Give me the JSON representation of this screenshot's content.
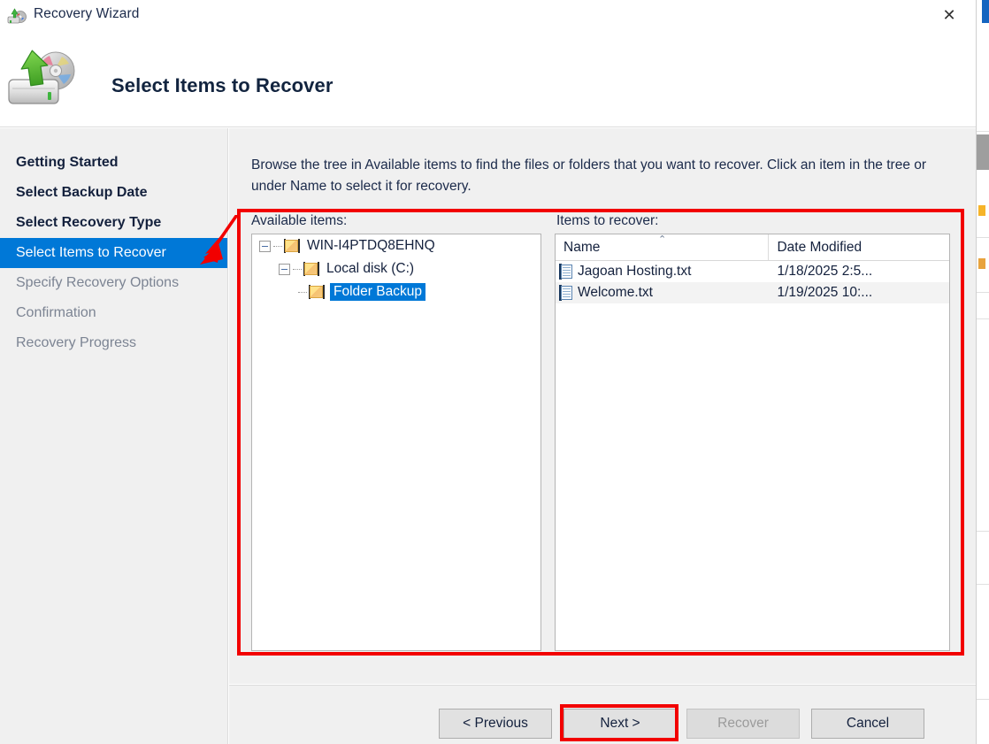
{
  "window": {
    "title": "Recovery Wizard",
    "title_icon": "recovery-wizard-icon",
    "close_label": "✕",
    "banner_title": "Select Items to Recover",
    "banner_icon": "backup-restore-icon"
  },
  "sidebar": {
    "items": [
      {
        "label": "Getting Started",
        "state": "done"
      },
      {
        "label": "Select Backup Date",
        "state": "done"
      },
      {
        "label": "Select Recovery Type",
        "state": "done"
      },
      {
        "label": "Select Items to Recover",
        "state": "active"
      },
      {
        "label": "Specify Recovery Options",
        "state": "pending"
      },
      {
        "label": "Confirmation",
        "state": "pending"
      },
      {
        "label": "Recovery Progress",
        "state": "pending"
      }
    ]
  },
  "main": {
    "instruction": "Browse the tree in Available items to find the files or folders that you want to recover. Click an item in the tree or under Name to select it for recovery.",
    "available_label": "Available items:",
    "items_label": "Items to recover:",
    "tree": [
      {
        "label": "WIN-I4PTDQ8EHNQ",
        "depth": 1,
        "expanded": true,
        "selected": false
      },
      {
        "label": "Local disk (C:)",
        "depth": 2,
        "expanded": true,
        "selected": false
      },
      {
        "label": "Folder Backup",
        "depth": 3,
        "expanded": false,
        "selected": true
      }
    ],
    "list": {
      "columns": [
        {
          "label": "Name",
          "sorted": "ascending",
          "sort_glyph": "⌃"
        },
        {
          "label": "Date Modified",
          "sorted": "none",
          "sort_glyph": ""
        }
      ],
      "rows": [
        {
          "name": "Jagoan Hosting.txt",
          "date": "1/18/2025 2:5...",
          "icon": "text-file-icon"
        },
        {
          "name": "Welcome.txt",
          "date": "1/19/2025 10:...",
          "icon": "text-file-icon"
        }
      ]
    }
  },
  "footer": {
    "previous": "< Previous",
    "next": "Next >",
    "recover": "Recover",
    "cancel": "Cancel",
    "recover_disabled": true
  },
  "annotations": {
    "accent_color": "#f20000",
    "highlight_color": "#0078d7",
    "arrow": "red-arrow-pointing-to-active-step",
    "boxes": [
      "panels-highlight-box",
      "next-button-highlight-box"
    ]
  }
}
